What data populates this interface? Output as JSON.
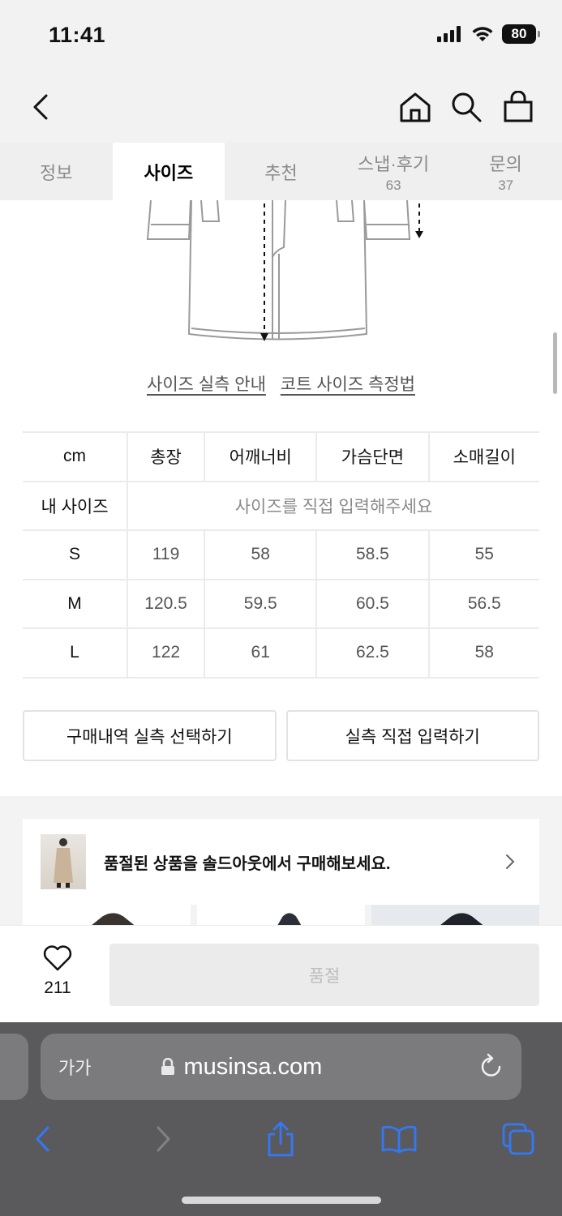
{
  "status": {
    "time": "11:41",
    "battery": "80"
  },
  "tabs": [
    {
      "label": "정보",
      "count": ""
    },
    {
      "label": "사이즈",
      "count": ""
    },
    {
      "label": "추천",
      "count": ""
    },
    {
      "label": "스냅·후기",
      "count": "63"
    },
    {
      "label": "문의",
      "count": "37"
    }
  ],
  "active_tab": "사이즈",
  "guide_links": {
    "size_guide": "사이즈 실측 안내",
    "coat_measure": "코트 사이즈 측정법"
  },
  "size_table": {
    "headers": [
      "cm",
      "총장",
      "어깨너비",
      "가슴단면",
      "소매길이"
    ],
    "my_size_label": "내 사이즈",
    "my_size_placeholder": "사이즈를 직접 입력해주세요",
    "rows": [
      {
        "size": "S",
        "values": [
          "119",
          "58",
          "58.5",
          "55"
        ]
      },
      {
        "size": "M",
        "values": [
          "120.5",
          "59.5",
          "60.5",
          "56.5"
        ]
      },
      {
        "size": "L",
        "values": [
          "122",
          "61",
          "62.5",
          "58"
        ]
      }
    ]
  },
  "actions": {
    "select_purchase": "구매내역 실측 선택하기",
    "direct_input": "실측 직접 입력하기"
  },
  "soldout_banner": {
    "text": "품절된 상품을 솔드아웃에서 구매해보세요."
  },
  "bottom": {
    "like_count": "211",
    "buy_label": "품절"
  },
  "safari": {
    "aa": "가가",
    "url": "musinsa.com"
  },
  "colors": {
    "link_blue": "#3478f6",
    "safari_bg": "#5a5a5d"
  }
}
